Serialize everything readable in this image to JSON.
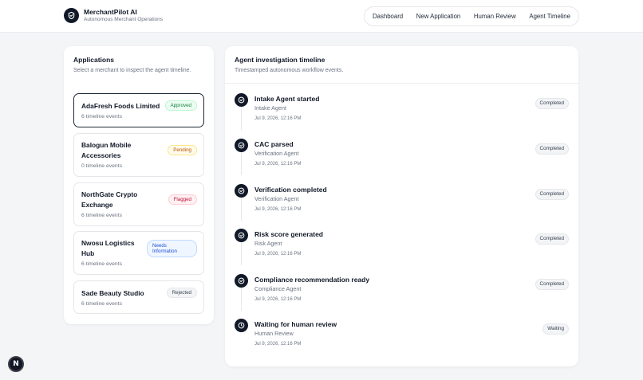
{
  "brand": {
    "title": "MerchantPilot AI",
    "subtitle": "Autonomous Merchant Operations",
    "logo_icon": "shield-check-icon"
  },
  "nav": {
    "items": [
      {
        "label": "Dashboard"
      },
      {
        "label": "New Application"
      },
      {
        "label": "Human Review"
      },
      {
        "label": "Agent Timeline"
      }
    ]
  },
  "applications": {
    "title": "Applications",
    "subtitle": "Select a merchant to inspect the agent timeline.",
    "items": [
      {
        "name": "AdaFresh Foods Limited",
        "events": "6 timeline events",
        "status": "Approved",
        "status_type": "approved",
        "selected": true
      },
      {
        "name": "Balogun Mobile Accessories",
        "events": "0 timeline events",
        "status": "Pending",
        "status_type": "pending",
        "selected": false
      },
      {
        "name": "NorthGate Crypto Exchange",
        "events": "6 timeline events",
        "status": "Flagged",
        "status_type": "flagged",
        "selected": false
      },
      {
        "name": "Nwosu Logistics Hub",
        "events": "6 timeline events",
        "status": "Needs Information",
        "status_type": "needs",
        "selected": false
      },
      {
        "name": "Sade Beauty Studio",
        "events": "6 timeline events",
        "status": "Rejected",
        "status_type": "rejected",
        "selected": false
      }
    ]
  },
  "timeline": {
    "title": "Agent investigation timeline",
    "subtitle": "Timestamped autonomous workflow events.",
    "events": [
      {
        "title": "Intake Agent started",
        "agent": "Intake Agent",
        "time": "Jul 9, 2026, 12:16 PM",
        "status": "Completed",
        "icon": "check-circle-icon"
      },
      {
        "title": "CAC parsed",
        "agent": "Verification Agent",
        "time": "Jul 9, 2026, 12:16 PM",
        "status": "Completed",
        "icon": "check-circle-icon"
      },
      {
        "title": "Verification completed",
        "agent": "Verification Agent",
        "time": "Jul 9, 2026, 12:16 PM",
        "status": "Completed",
        "icon": "check-circle-icon"
      },
      {
        "title": "Risk score generated",
        "agent": "Risk Agent",
        "time": "Jul 9, 2026, 12:16 PM",
        "status": "Completed",
        "icon": "check-circle-icon"
      },
      {
        "title": "Compliance recommendation ready",
        "agent": "Compliance Agent",
        "time": "Jul 9, 2026, 12:16 PM",
        "status": "Completed",
        "icon": "check-circle-icon"
      },
      {
        "title": "Waiting for human review",
        "agent": "Human Review",
        "time": "Jul 9, 2026, 12:16 PM",
        "status": "Waiting",
        "icon": "clock-icon"
      }
    ]
  },
  "devtools": {
    "label": "N"
  },
  "colors": {
    "accent": "#111827",
    "background": "#f4f5f7",
    "approved": "#15803d",
    "pending": "#b45309",
    "flagged": "#be123c",
    "needs_info": "#1d4ed8"
  }
}
